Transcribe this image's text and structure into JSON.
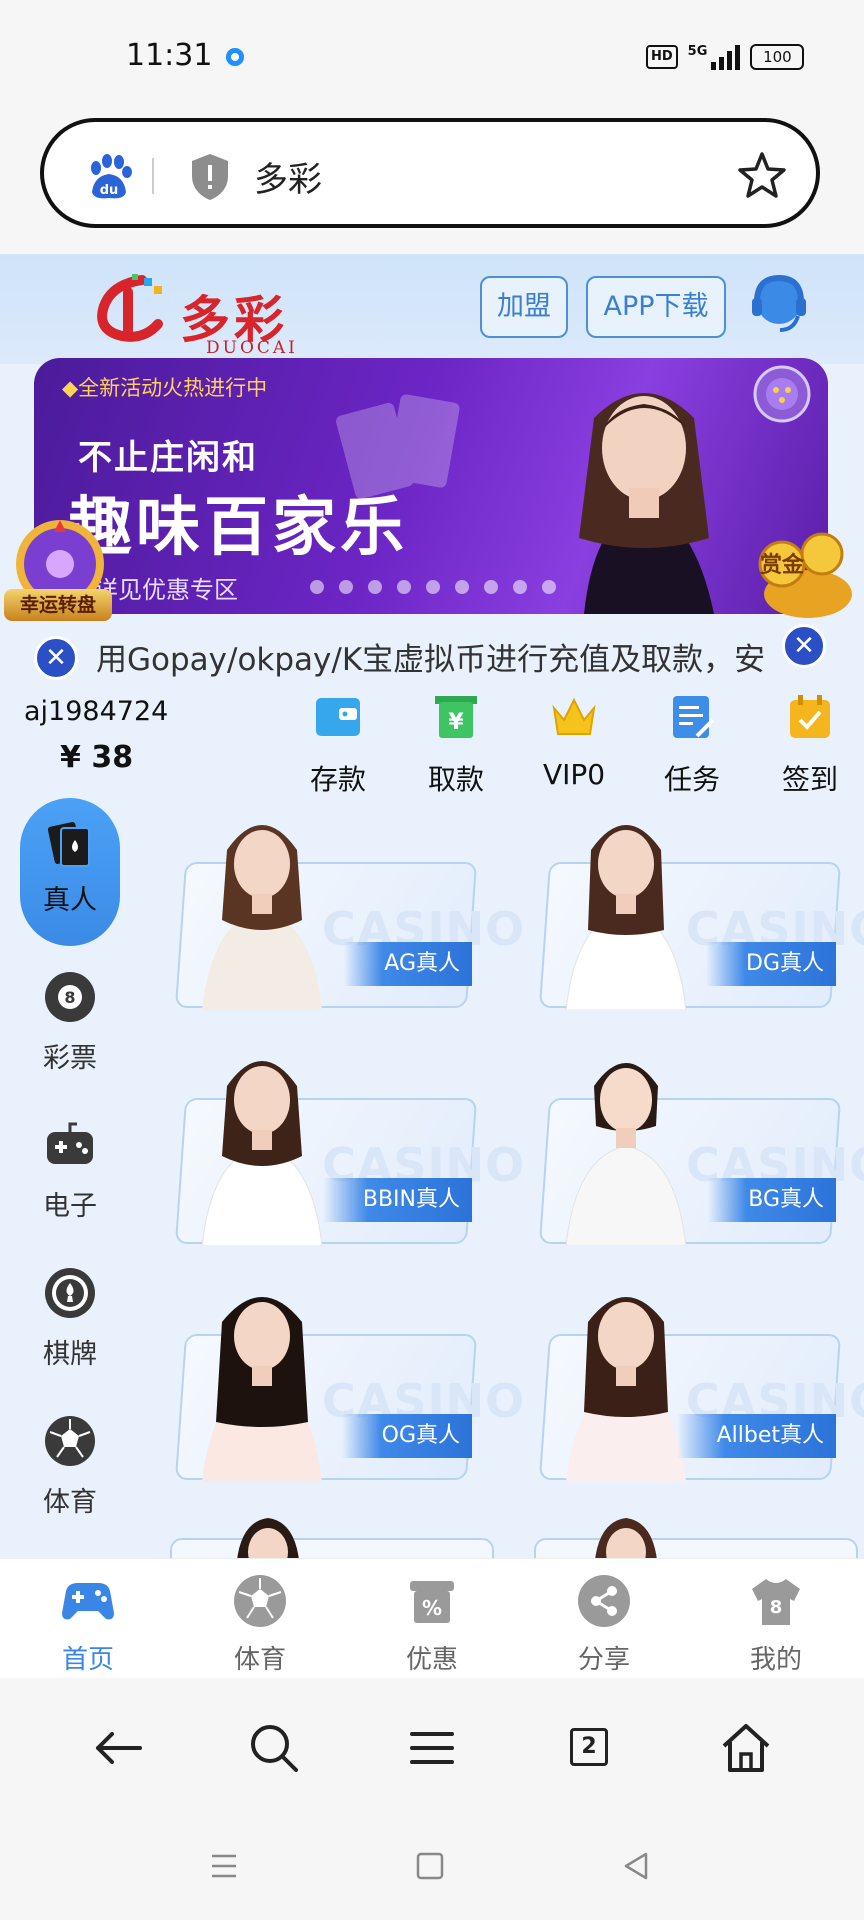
{
  "status": {
    "time": "11:31",
    "hd": "HD",
    "network": "5G",
    "battery": "100"
  },
  "url_bar": {
    "text": "多彩"
  },
  "site": {
    "logo_text": "多彩",
    "logo_sub": "DUOCAI",
    "join_label": "加盟",
    "app_label": "APP下载"
  },
  "banner": {
    "subtitle": "◆全新活动火热进行中",
    "line1": "不止庄闲和",
    "line2": "趣味百家乐",
    "line3": "详见优惠专区",
    "wheel_label": "幸运转盘",
    "bonus_label": "赏金"
  },
  "marquee": {
    "text": "用Gopay/okpay/K宝虚拟币进行充值及取款，安"
  },
  "user": {
    "username": "aj1984724",
    "balance": "¥ 38"
  },
  "quick_actions": [
    {
      "label": "存款",
      "icon": "wallet-icon"
    },
    {
      "label": "取款",
      "icon": "withdraw-icon"
    },
    {
      "label": "VIP0",
      "icon": "crown-icon"
    },
    {
      "label": "任务",
      "icon": "task-icon"
    },
    {
      "label": "签到",
      "icon": "checkin-icon"
    }
  ],
  "categories": [
    {
      "label": "真人",
      "icon": "cards-icon",
      "active": true
    },
    {
      "label": "彩票",
      "icon": "lottery-ball-icon"
    },
    {
      "label": "电子",
      "icon": "gamepad-icon"
    },
    {
      "label": "棋牌",
      "icon": "poker-chip-icon"
    },
    {
      "label": "体育",
      "icon": "soccer-ball-icon"
    }
  ],
  "games": [
    {
      "label": "AG真人",
      "watermark": "CASINO"
    },
    {
      "label": "DG真人",
      "watermark": "CASINO"
    },
    {
      "label": "BBIN真人",
      "watermark": "CASINO"
    },
    {
      "label": "BG真人",
      "watermark": "CASINO"
    },
    {
      "label": "OG真人",
      "watermark": "CASINO"
    },
    {
      "label": "Allbet真人",
      "watermark": "CASINO"
    }
  ],
  "tabbar": [
    {
      "label": "首页",
      "icon": "gamepad-icon",
      "active": true
    },
    {
      "label": "体育",
      "icon": "soccer-ball-icon"
    },
    {
      "label": "优惠",
      "icon": "discount-icon"
    },
    {
      "label": "分享",
      "icon": "share-icon"
    },
    {
      "label": "我的",
      "icon": "shirt-icon"
    }
  ],
  "browser": {
    "tab_count": "2"
  },
  "colors": {
    "accent": "#3a86e6",
    "brand_red": "#d8242b",
    "banner_purple": "#6b25c4"
  }
}
